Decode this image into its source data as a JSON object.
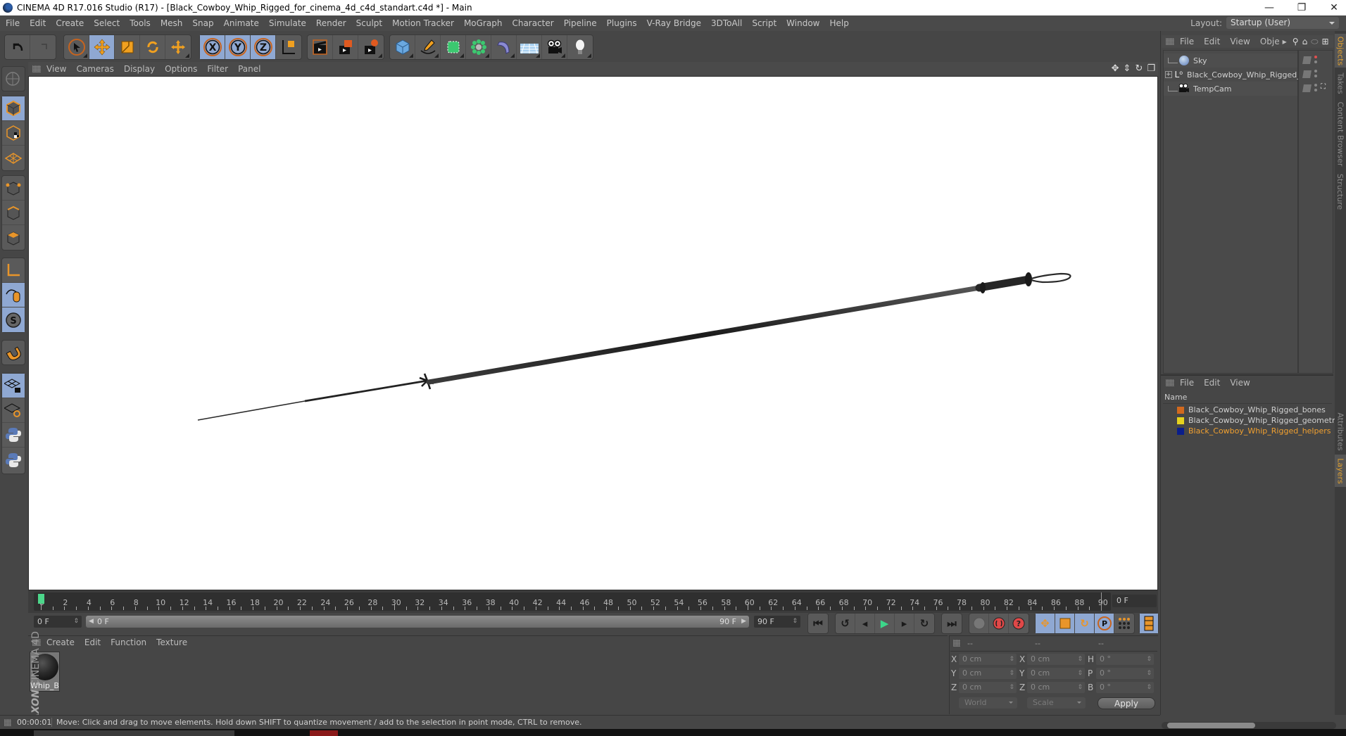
{
  "window": {
    "title": "CINEMA 4D R17.016 Studio (R17) - [Black_Cowboy_Whip_Rigged_for_cinema_4d_c4d_standart.c4d *] - Main",
    "controls": [
      "minimize",
      "restore",
      "close"
    ]
  },
  "menubar": [
    "File",
    "Edit",
    "Create",
    "Select",
    "Tools",
    "Mesh",
    "Snap",
    "Animate",
    "Simulate",
    "Render",
    "Sculpt",
    "Motion Tracker",
    "MoGraph",
    "Character",
    "Pipeline",
    "Plugins",
    "V-Ray Bridge",
    "3DToAll",
    "Script",
    "Window",
    "Help"
  ],
  "layout": {
    "label": "Layout:",
    "value": "Startup (User)"
  },
  "toolbar": {
    "groups": [
      [
        "undo-icon",
        "redo-icon"
      ],
      [
        "live-selection-icon",
        "move-icon",
        "scale-icon",
        "rotate-icon",
        "recent-tool-icon"
      ],
      [
        "x-axis-icon",
        "y-axis-icon",
        "z-axis-icon",
        "coordinate-system-icon"
      ],
      [
        "render-view-icon",
        "render-picture-viewer-icon",
        "render-settings-icon"
      ],
      [
        "cube-icon",
        "pen-spline-icon",
        "subdivision-icon",
        "cloner-icon",
        "deformer-icon",
        "floor-icon",
        "camera-icon",
        "light-icon"
      ]
    ]
  },
  "left_toolbar": [
    "make-editable-icon",
    "model-mode-icon",
    "texture-mode-icon",
    "workplane-mode-icon",
    "points-mode-icon",
    "edges-mode-icon",
    "polygons-mode-icon",
    "axis-mode-icon",
    "tweak-mode-icon",
    "solo-icon",
    "snap-icon",
    "lock-workplane-icon",
    "planar-workplane-icon",
    "python-icon",
    "python-2-icon"
  ],
  "viewport": {
    "menu": [
      "View",
      "Cameras",
      "Display",
      "Options",
      "Filter",
      "Panel"
    ],
    "nav_icons": [
      "move-view-icon",
      "zoom-view-icon",
      "rotate-view-icon",
      "maximize-view-icon"
    ],
    "object": "Black cowboy whip"
  },
  "timeline": {
    "ticks": [
      "0",
      "2",
      "4",
      "6",
      "8",
      "10",
      "12",
      "14",
      "16",
      "18",
      "20",
      "22",
      "24",
      "26",
      "28",
      "30",
      "32",
      "34",
      "36",
      "38",
      "40",
      "42",
      "44",
      "46",
      "48",
      "50",
      "52",
      "54",
      "56",
      "58",
      "60",
      "62",
      "64",
      "66",
      "68",
      "70",
      "72",
      "74",
      "76",
      "78",
      "80",
      "82",
      "84",
      "86",
      "88",
      "90"
    ],
    "current_frame_field": "0 F",
    "start_field": "0 F",
    "slider_start": "0 F",
    "slider_end": "90 F",
    "end_field": "90 F",
    "playhead_frame": 0
  },
  "playback": {
    "buttons": [
      "go-to-start-icon",
      "previous-keyframe-icon",
      "previous-frame-icon",
      "play-icon",
      "next-frame-icon",
      "next-keyframe-icon",
      "go-to-end-icon"
    ],
    "record": [
      "autokey-icon",
      "record-icon",
      "keyframe-selection-icon"
    ],
    "key_types": [
      "key-position-icon",
      "key-scale-icon",
      "key-rotation-icon",
      "key-parameter-icon",
      "key-pla-icon"
    ],
    "timeline_button": "timeline-icon"
  },
  "material_manager": {
    "menu": [
      "Create",
      "Edit",
      "Function",
      "Texture"
    ],
    "materials": [
      {
        "name": "Whip_Bl"
      }
    ]
  },
  "brand": {
    "maxon": "MAXON",
    "product": "CINEMA 4D"
  },
  "coordinates": {
    "headers": [
      "--",
      "--",
      "--"
    ],
    "position": {
      "X": "0 cm",
      "Y": "0 cm",
      "Z": "0 cm"
    },
    "size": {
      "X": "0 cm",
      "Y": "0 cm",
      "Z": "0 cm"
    },
    "rotation": {
      "H": "0 °",
      "P": "0 °",
      "B": "0 °"
    },
    "mode_dropdown": "World",
    "size_dropdown": "Scale",
    "apply_label": "Apply"
  },
  "status": {
    "time": "00:00:01",
    "message": "Move: Click and drag to move elements. Hold down SHIFT to quantize movement / add to the selection in point mode, CTRL to remove."
  },
  "object_manager": {
    "menu": [
      "File",
      "Edit",
      "View",
      "Obje"
    ],
    "objects": [
      {
        "name": "Sky",
        "icon": "sky-icon",
        "expandable": false
      },
      {
        "name": "Black_Cowboy_Whip_Rigged_",
        "icon": "null-object-icon",
        "expandable": true
      },
      {
        "name": "TempCam",
        "icon": "camera-icon",
        "expandable": false
      }
    ]
  },
  "layer_manager": {
    "menu": [
      "File",
      "Edit",
      "View"
    ],
    "column": "Name",
    "layers": [
      {
        "name": "Black_Cowboy_Whip_Rigged_bones",
        "color": "#d2691e",
        "selected": false
      },
      {
        "name": "Black_Cowboy_Whip_Rigged_geometry",
        "color": "#e6d21e",
        "selected": false
      },
      {
        "name": "Black_Cowboy_Whip_Rigged_helpers",
        "color": "#0a1e8c",
        "selected": true
      }
    ]
  },
  "side_tabs": [
    {
      "label": "Objects",
      "active": true
    },
    {
      "label": "Takes",
      "active": false
    },
    {
      "label": "Content Browser",
      "active": false
    },
    {
      "label": "Structure",
      "active": false
    },
    {
      "label": "Attributes",
      "active": false
    },
    {
      "label": "Layers",
      "active": true
    }
  ],
  "colors": {
    "accent_blue": "#8fa8d2",
    "accent_orange": "#e8952a",
    "active_tab": "#e0a030",
    "playhead": "#4cd68a"
  }
}
